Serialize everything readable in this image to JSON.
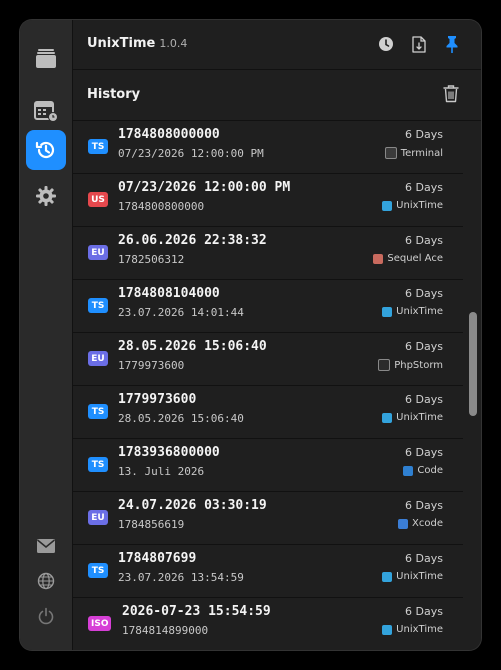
{
  "app": {
    "title": "UnixTime",
    "version": "1.0.4"
  },
  "section": {
    "title": "History"
  },
  "colors": {
    "TS": "#1f8fff",
    "US": "#e5484d",
    "EU": "#6b6ee6",
    "ISO": "#d63fd6",
    "accent": "#1f8fff"
  },
  "sidebar": {
    "items": [
      {
        "name": "stack-icon"
      },
      {
        "name": "calendar-badge-icon"
      },
      {
        "name": "history-icon",
        "active": true
      },
      {
        "name": "gear-icon"
      }
    ],
    "bottom": [
      {
        "name": "mail-icon"
      },
      {
        "name": "globe-icon"
      },
      {
        "name": "power-icon"
      }
    ]
  },
  "toolbar": {
    "icons": [
      "clock-icon",
      "document-arrow-icon",
      "pin-icon"
    ]
  },
  "history": [
    {
      "badge": "TS",
      "primary": "1784808000000",
      "secondary": "07/23/2026 12:00:00 PM",
      "ago": "6 Days",
      "source": "Terminal",
      "source_icon": "terminal-icon"
    },
    {
      "badge": "US",
      "primary": "07/23/2026 12:00:00 PM",
      "secondary": "1784800800000",
      "ago": "6 Days",
      "source": "UnixTime",
      "source_icon": "unixtime-icon"
    },
    {
      "badge": "EU",
      "primary": "26.06.2026 22:38:32",
      "secondary": "1782506312",
      "ago": "6 Days",
      "source": "Sequel Ace",
      "source_icon": "sequel-ace-icon"
    },
    {
      "badge": "TS",
      "primary": "1784808104000",
      "secondary": "23.07.2026 14:01:44",
      "ago": "6 Days",
      "source": "UnixTime",
      "source_icon": "unixtime-icon"
    },
    {
      "badge": "EU",
      "primary": "28.05.2026 15:06:40",
      "secondary": "1779973600",
      "ago": "6 Days",
      "source": "PhpStorm",
      "source_icon": "phpstorm-icon"
    },
    {
      "badge": "TS",
      "primary": "1779973600",
      "secondary": "28.05.2026 15:06:40",
      "ago": "6 Days",
      "source": "UnixTime",
      "source_icon": "unixtime-icon"
    },
    {
      "badge": "TS",
      "primary": "1783936800000",
      "secondary": "13. Juli 2026",
      "ago": "6 Days",
      "source": "Code",
      "source_icon": "vscode-icon"
    },
    {
      "badge": "EU",
      "primary": "24.07.2026 03:30:19",
      "secondary": "1784856619",
      "ago": "6 Days",
      "source": "Xcode",
      "source_icon": "xcode-icon"
    },
    {
      "badge": "TS",
      "primary": "1784807699",
      "secondary": "23.07.2026 13:54:59",
      "ago": "6 Days",
      "source": "UnixTime",
      "source_icon": "unixtime-icon"
    },
    {
      "badge": "ISO",
      "primary": "2026-07-23 15:54:59",
      "secondary": "1784814899000",
      "ago": "6 Days",
      "source": "UnixTime",
      "source_icon": "unixtime-icon"
    }
  ]
}
